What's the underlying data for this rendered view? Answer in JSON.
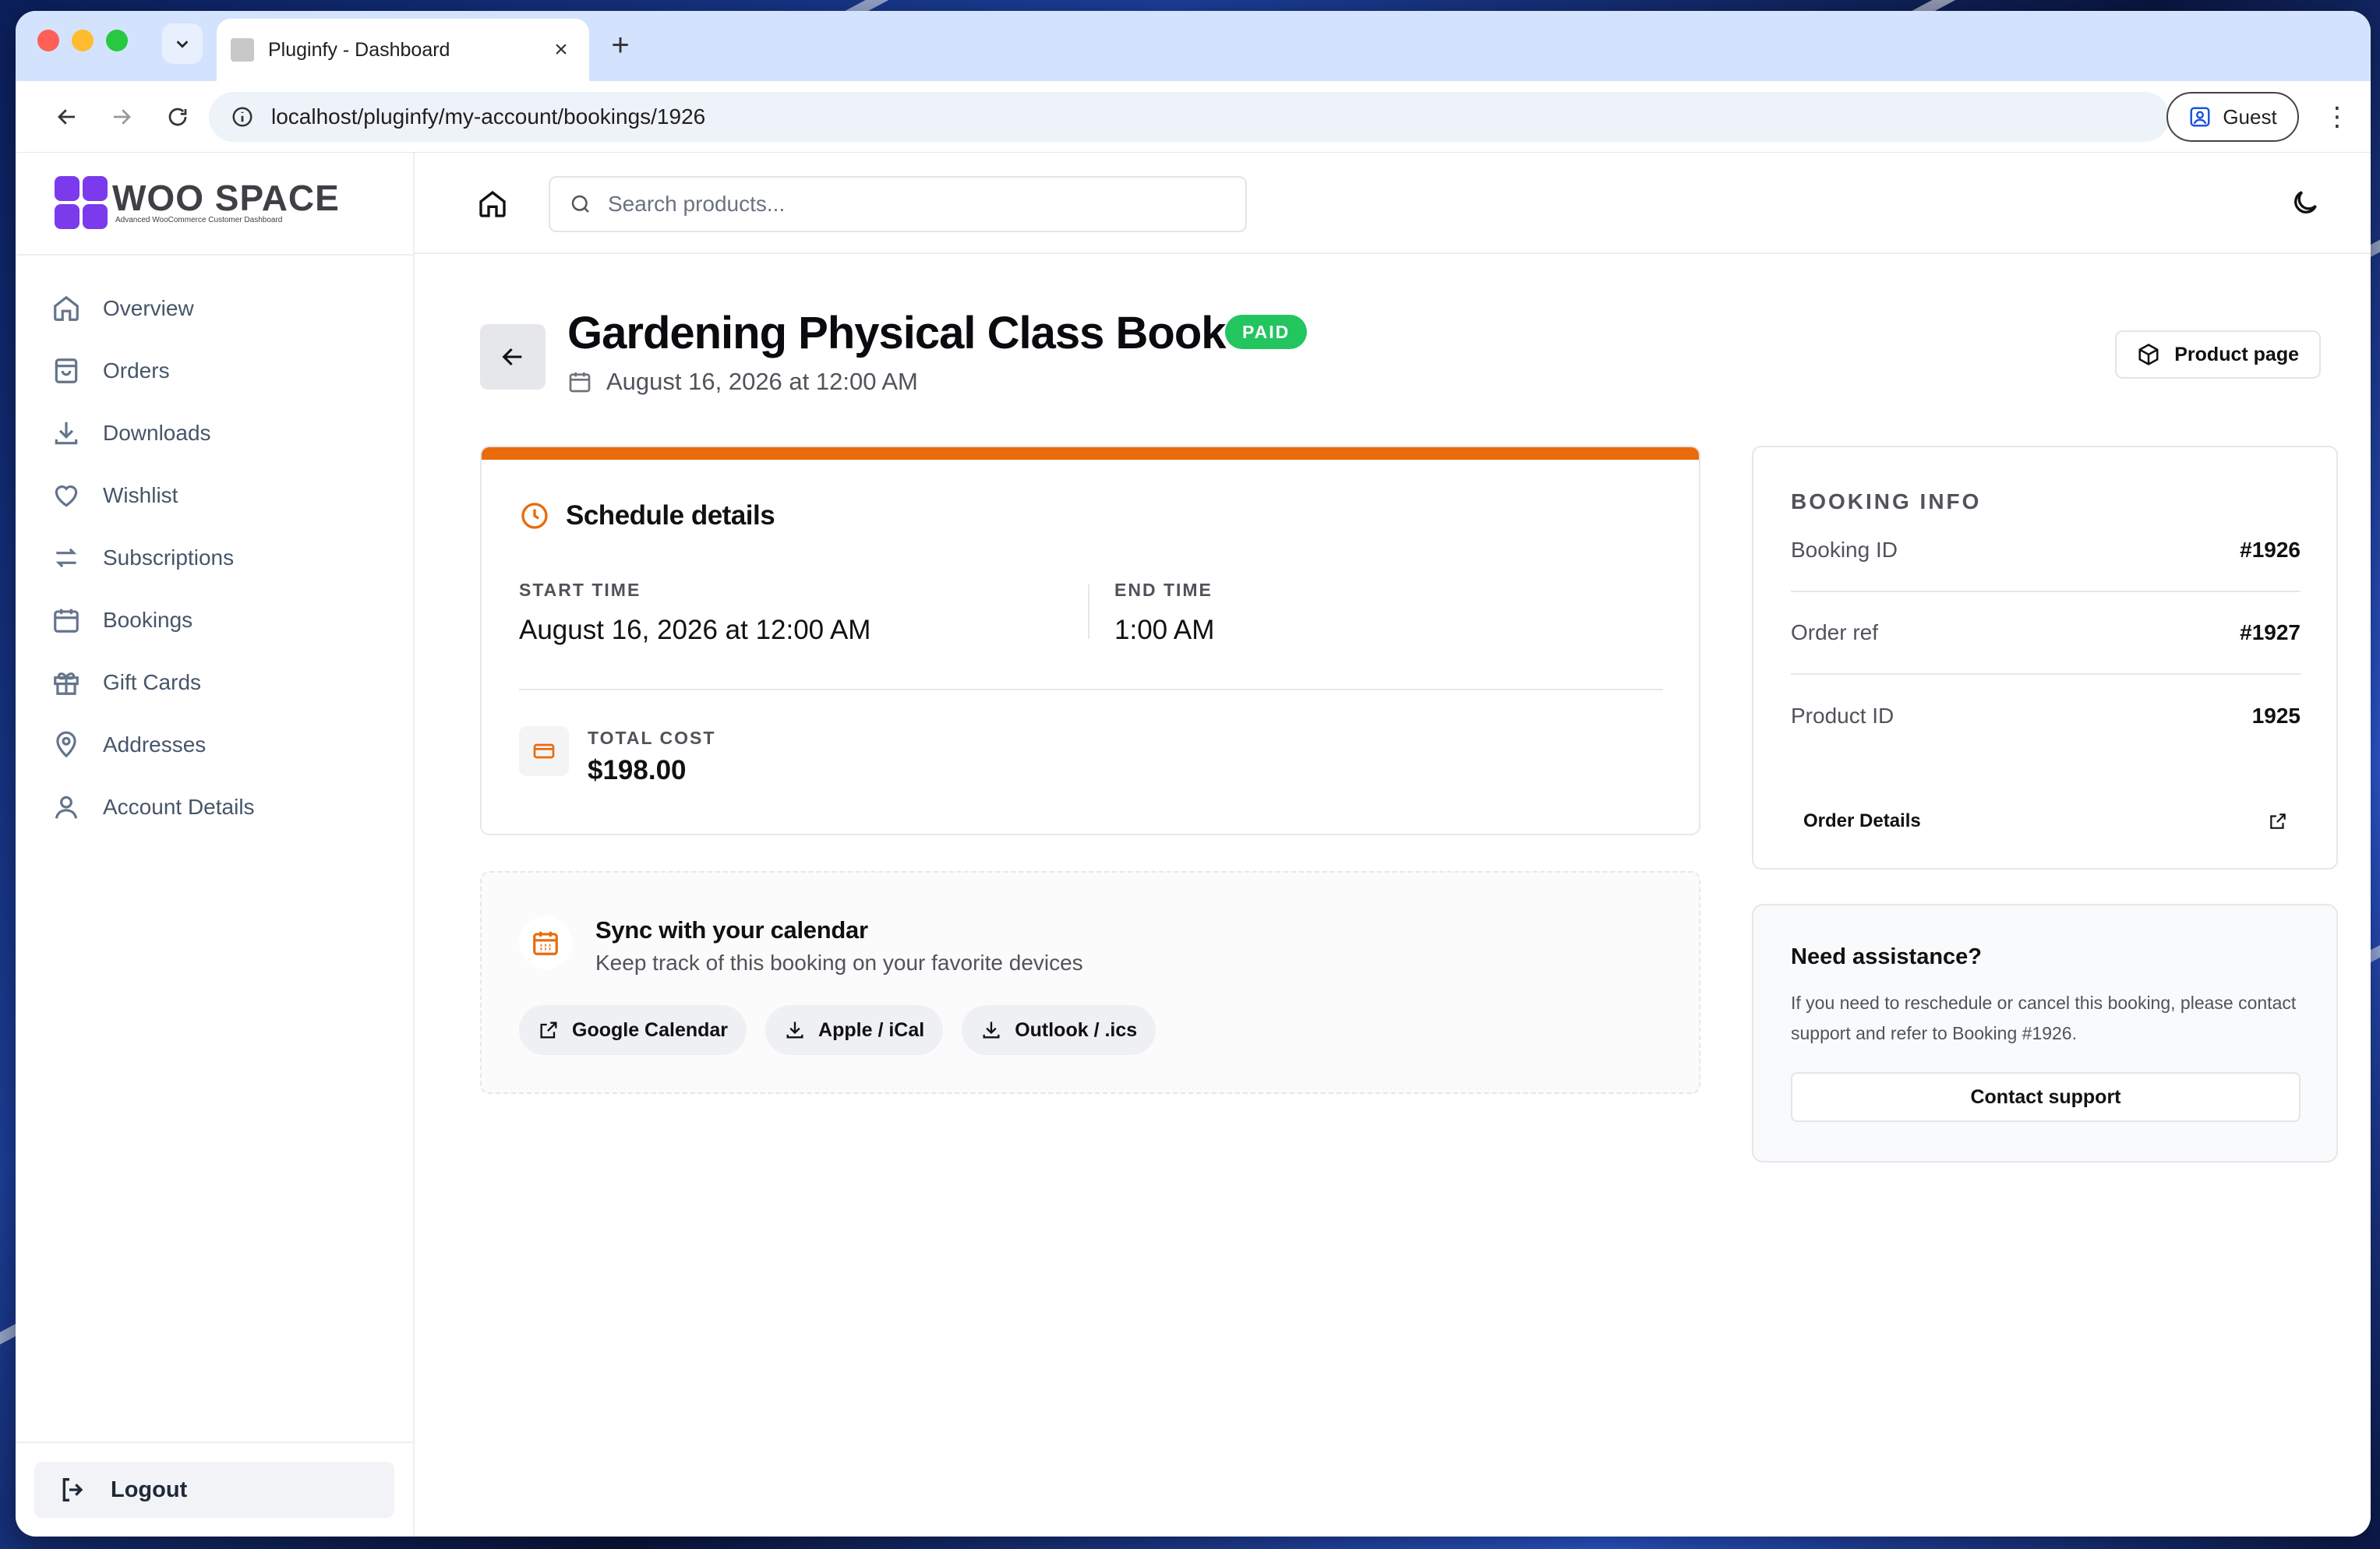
{
  "browser": {
    "tab_title": "Pluginfy - Dashboard",
    "url": "localhost/pluginfy/my-account/bookings/1926",
    "profile_label": "Guest",
    "new_tab": "+",
    "close_tab": "×",
    "menu": "⋮"
  },
  "brand": {
    "name": "WOO SPACE",
    "tagline": "Advanced WooCommerce Customer Dashboard",
    "accent": "#7c3aed"
  },
  "sidebar": {
    "items": [
      {
        "label": "Overview",
        "icon": "home-icon"
      },
      {
        "label": "Orders",
        "icon": "shopping-bag-icon"
      },
      {
        "label": "Downloads",
        "icon": "download-icon"
      },
      {
        "label": "Wishlist",
        "icon": "heart-icon"
      },
      {
        "label": "Subscriptions",
        "icon": "repeat-icon"
      },
      {
        "label": "Bookings",
        "icon": "calendar-icon"
      },
      {
        "label": "Gift Cards",
        "icon": "gift-icon"
      },
      {
        "label": "Addresses",
        "icon": "map-pin-icon"
      },
      {
        "label": "Account Details",
        "icon": "user-icon"
      }
    ],
    "logout_label": "Logout"
  },
  "header": {
    "search_placeholder": "Search products..."
  },
  "booking": {
    "title": "Gardening Physical Class Book",
    "status": "PAID",
    "status_color": "#22c55e",
    "date": "August 16, 2026 at 12:00 AM",
    "product_page_label": "Product page"
  },
  "schedule": {
    "heading": "Schedule details",
    "accent": "#ea6a0c",
    "start_label": "START TIME",
    "start_value": "August 16, 2026 at 12:00 AM",
    "end_label": "END TIME",
    "end_value": "1:00 AM",
    "cost_label": "TOTAL COST",
    "cost_value": "$198.00"
  },
  "sync": {
    "title": "Sync with your calendar",
    "subtitle": "Keep track of this booking on your favorite devices",
    "buttons": [
      {
        "label": "Google Calendar",
        "icon": "external-link-icon"
      },
      {
        "label": "Apple / iCal",
        "icon": "download-icon"
      },
      {
        "label": "Outlook / .ics",
        "icon": "download-icon"
      }
    ]
  },
  "info": {
    "title": "BOOKING INFO",
    "rows": [
      {
        "label": "Booking ID",
        "value": "#1926"
      },
      {
        "label": "Order ref",
        "value": "#1927"
      },
      {
        "label": "Product ID",
        "value": "1925"
      }
    ],
    "order_details_label": "Order Details"
  },
  "help": {
    "title": "Need assistance?",
    "text": "If you need to reschedule or cancel this booking, please contact support and refer to Booking #1926.",
    "button": "Contact support"
  }
}
